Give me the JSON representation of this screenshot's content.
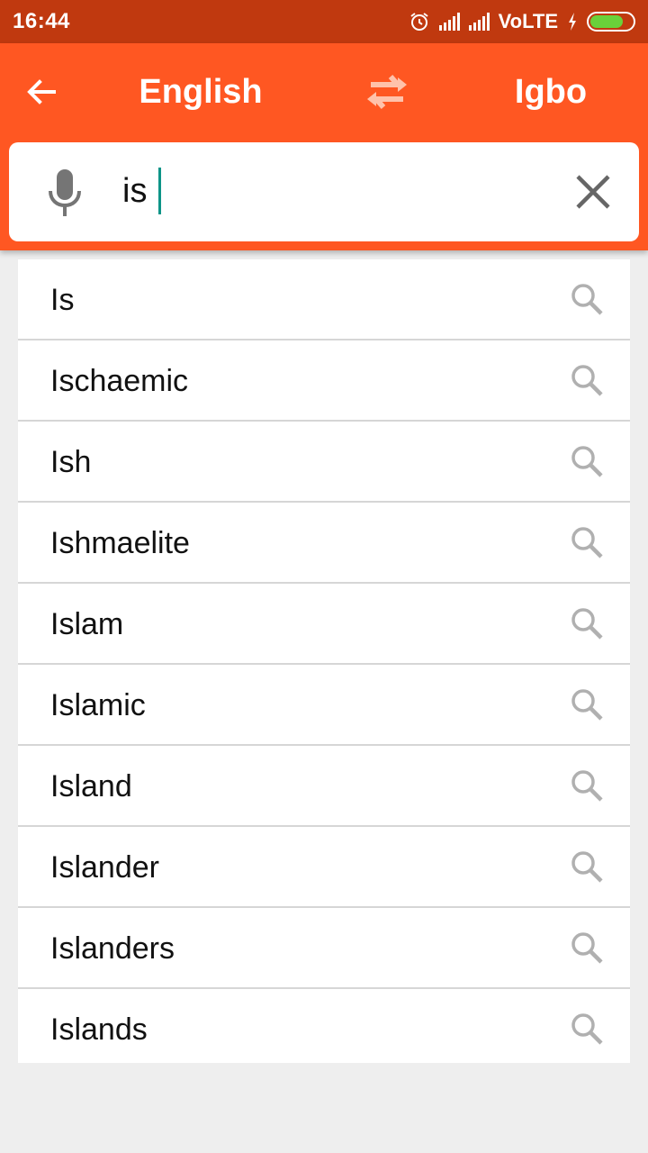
{
  "status_bar": {
    "time": "16:44",
    "network": "VoLTE",
    "icons": [
      "alarm-icon",
      "signal-icon",
      "signal-icon",
      "charging-icon",
      "battery-icon"
    ],
    "battery_color": "#6ad13a"
  },
  "app_bar": {
    "back_icon": "arrow-left-icon",
    "source_language": "English",
    "swap_icon": "swap-arrows-icon",
    "target_language": "Igbo",
    "color": "#ff5722"
  },
  "search": {
    "mic_icon": "microphone-icon",
    "value": "is",
    "clear_icon": "close-icon"
  },
  "results": [
    {
      "label": "Is"
    },
    {
      "label": "Ischaemic"
    },
    {
      "label": "Ish"
    },
    {
      "label": "Ishmaelite"
    },
    {
      "label": "Islam"
    },
    {
      "label": "Islamic"
    },
    {
      "label": "Island"
    },
    {
      "label": "Islander"
    },
    {
      "label": "Islanders"
    },
    {
      "label": "Islands"
    }
  ]
}
